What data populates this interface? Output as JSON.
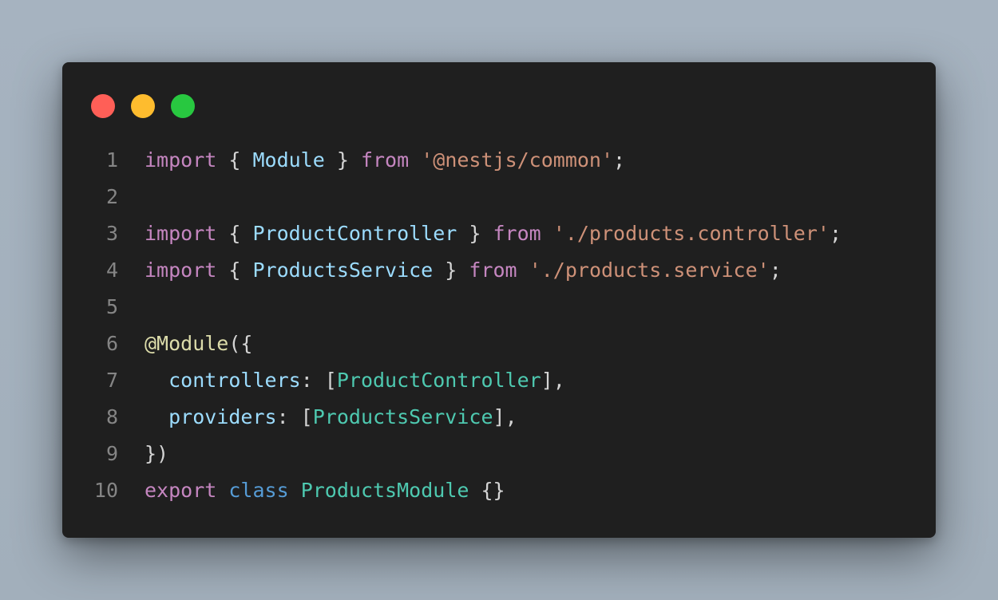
{
  "window": {
    "controls": {
      "close_color": "#ff5f57",
      "minimize_color": "#febc2e",
      "maximize_color": "#28c840"
    }
  },
  "colors": {
    "keyword": "#c586c0",
    "punct": "#d4d4d4",
    "variable": "#9cdcfe",
    "string": "#ce9178",
    "decorator": "#dcdcaa",
    "type": "#4ec9b0",
    "storage": "#569cd6",
    "line_number": "#858585",
    "background": "#1f1f1f"
  },
  "code": {
    "lines": [
      {
        "number": "1",
        "tokens": [
          {
            "text": "import",
            "kind": "keyword"
          },
          {
            "text": " { ",
            "kind": "punct"
          },
          {
            "text": "Module",
            "kind": "variable"
          },
          {
            "text": " } ",
            "kind": "punct"
          },
          {
            "text": "from",
            "kind": "keyword"
          },
          {
            "text": " ",
            "kind": "punct"
          },
          {
            "text": "'@nestjs/common'",
            "kind": "string"
          },
          {
            "text": ";",
            "kind": "punct"
          }
        ]
      },
      {
        "number": "2",
        "tokens": []
      },
      {
        "number": "3",
        "tokens": [
          {
            "text": "import",
            "kind": "keyword"
          },
          {
            "text": " { ",
            "kind": "punct"
          },
          {
            "text": "ProductController",
            "kind": "variable"
          },
          {
            "text": " } ",
            "kind": "punct"
          },
          {
            "text": "from",
            "kind": "keyword"
          },
          {
            "text": " ",
            "kind": "punct"
          },
          {
            "text": "'./products.controller'",
            "kind": "string"
          },
          {
            "text": ";",
            "kind": "punct"
          }
        ]
      },
      {
        "number": "4",
        "tokens": [
          {
            "text": "import",
            "kind": "keyword"
          },
          {
            "text": " { ",
            "kind": "punct"
          },
          {
            "text": "ProductsService",
            "kind": "variable"
          },
          {
            "text": " } ",
            "kind": "punct"
          },
          {
            "text": "from",
            "kind": "keyword"
          },
          {
            "text": " ",
            "kind": "punct"
          },
          {
            "text": "'./products.service'",
            "kind": "string"
          },
          {
            "text": ";",
            "kind": "punct"
          }
        ]
      },
      {
        "number": "5",
        "tokens": []
      },
      {
        "number": "6",
        "tokens": [
          {
            "text": "@Module",
            "kind": "decorator"
          },
          {
            "text": "({",
            "kind": "punct"
          }
        ]
      },
      {
        "number": "7",
        "tokens": [
          {
            "text": "  ",
            "kind": "punct"
          },
          {
            "text": "controllers",
            "kind": "variable"
          },
          {
            "text": ": [",
            "kind": "punct"
          },
          {
            "text": "ProductController",
            "kind": "type"
          },
          {
            "text": "],",
            "kind": "punct"
          }
        ]
      },
      {
        "number": "8",
        "tokens": [
          {
            "text": "  ",
            "kind": "punct"
          },
          {
            "text": "providers",
            "kind": "variable"
          },
          {
            "text": ": [",
            "kind": "punct"
          },
          {
            "text": "ProductsService",
            "kind": "type"
          },
          {
            "text": "],",
            "kind": "punct"
          }
        ]
      },
      {
        "number": "9",
        "tokens": [
          {
            "text": "})",
            "kind": "punct"
          }
        ]
      },
      {
        "number": "10",
        "tokens": [
          {
            "text": "export",
            "kind": "keyword"
          },
          {
            "text": " ",
            "kind": "punct"
          },
          {
            "text": "class",
            "kind": "storage"
          },
          {
            "text": " ",
            "kind": "punct"
          },
          {
            "text": "ProductsModule",
            "kind": "type"
          },
          {
            "text": " {}",
            "kind": "punct"
          }
        ]
      }
    ]
  }
}
